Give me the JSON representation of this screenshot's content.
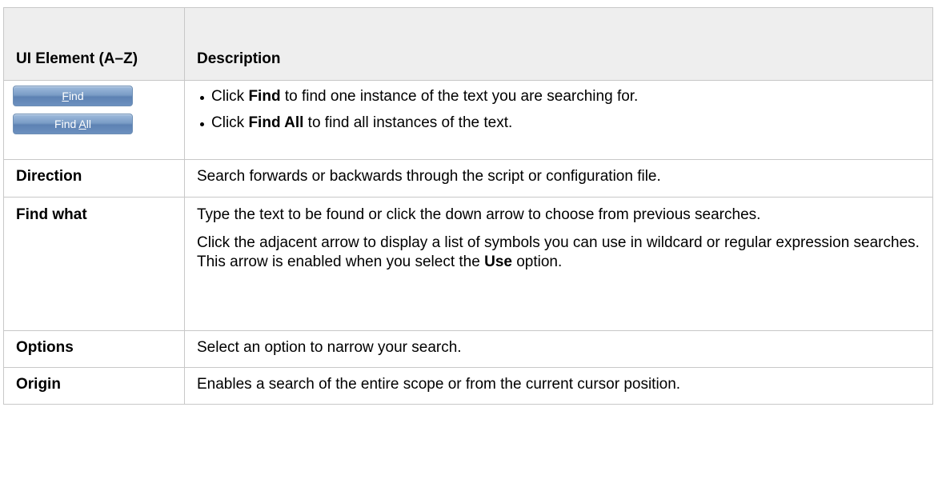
{
  "header": {
    "col1": "UI Element (A–Z)",
    "col2": "Description"
  },
  "rows": [
    {
      "buttons": [
        {
          "prefix": "",
          "accel": "F",
          "suffix": "ind"
        },
        {
          "prefix": "Find ",
          "accel": "A",
          "suffix": "ll"
        }
      ],
      "bullets": [
        {
          "pre": "Click ",
          "bold": "Find",
          "post": " to find one instance of the text you are searching for."
        },
        {
          "pre": "Click ",
          "bold": "Find All",
          "post": " to find all instances of the text."
        }
      ]
    },
    {
      "label": "Direction",
      "text": "Search forwards or backwards through the script or configuration file."
    },
    {
      "label": "Find what",
      "para1": "Type the text to be found or click the down arrow to choose from previous searches.",
      "para2_pre": "Click the adjacent arrow to display a list of symbols you can use in wildcard or regular expression searches. This arrow is enabled when you select the ",
      "para2_bold": "Use",
      "para2_post": " option."
    },
    {
      "label": "Options",
      "text": "Select an option to narrow your search."
    },
    {
      "label": "Origin",
      "text": "Enables a search of the entire scope or from the current cursor position."
    }
  ]
}
